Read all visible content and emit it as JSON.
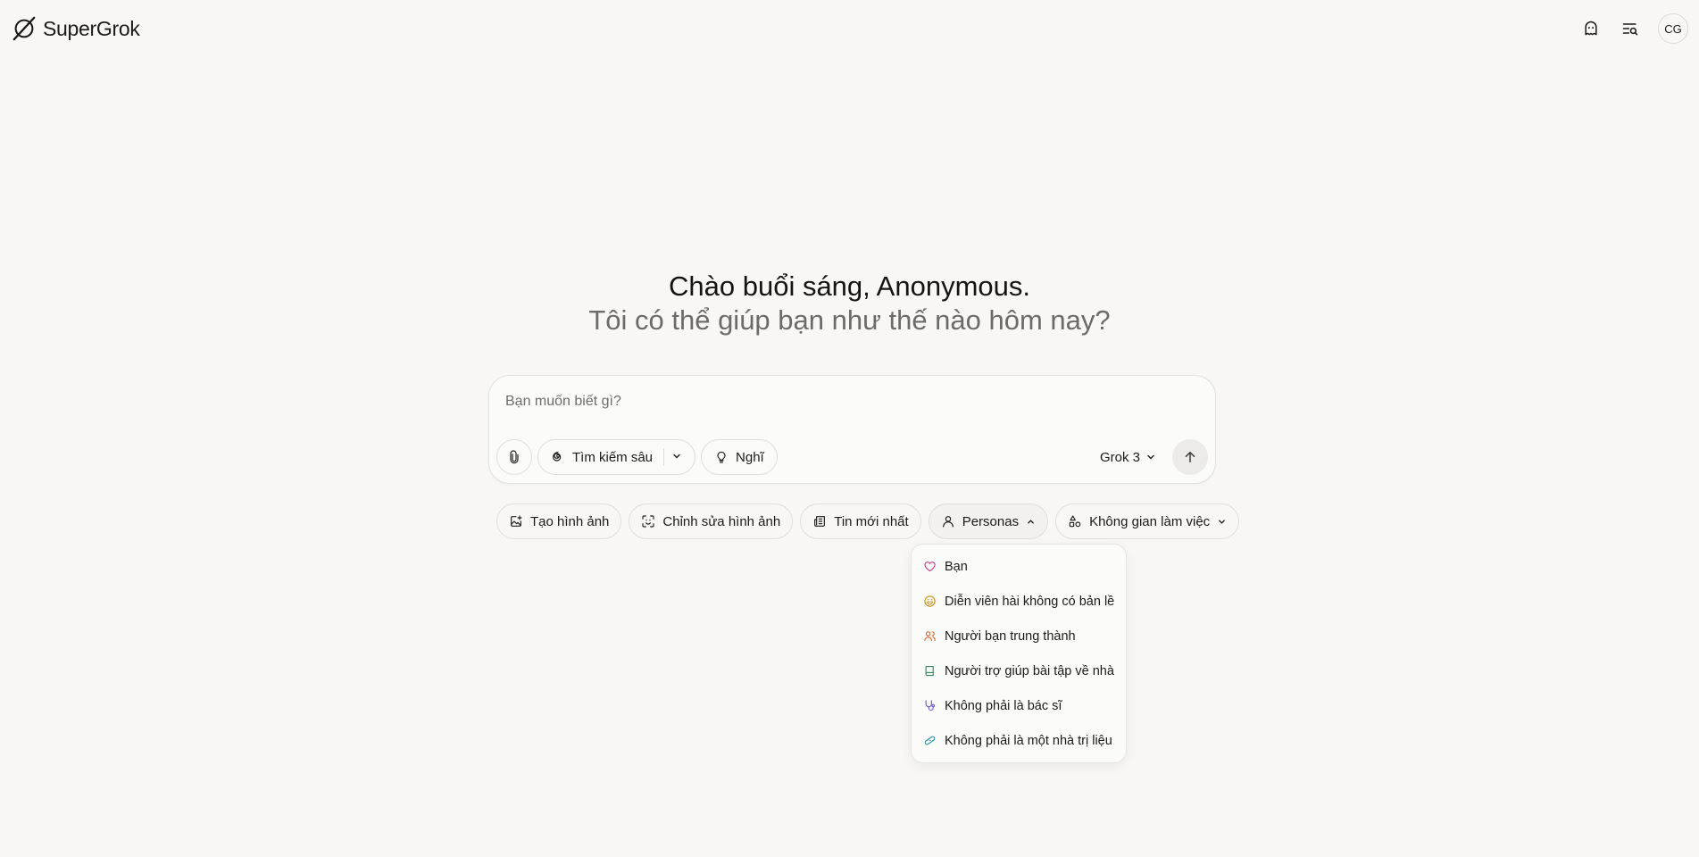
{
  "header": {
    "brand": "SuperGrok",
    "avatar_initials": "CG",
    "icons": [
      "ghost-icon",
      "history-search-icon"
    ]
  },
  "greeting": {
    "line1": "Chào buổi sáng, Anonymous.",
    "line2": "Tôi có thể giúp bạn như thế nào hôm nay?"
  },
  "composer": {
    "placeholder": "Bạn muốn biết gì?",
    "deep_search_label": "Tìm kiếm sâu",
    "think_label": "Nghĩ",
    "model_label": "Grok 3"
  },
  "suggestions": [
    {
      "label": "Tạo hình ảnh",
      "icon": "image-plus-icon"
    },
    {
      "label": "Chỉnh sửa hình ảnh",
      "icon": "scan-face-icon"
    },
    {
      "label": "Tin mới nhất",
      "icon": "newspaper-icon"
    },
    {
      "label": "Personas",
      "icon": "person-icon"
    },
    {
      "label": "Không gian làm việc",
      "icon": "shapes-icon"
    }
  ],
  "personas_menu": [
    {
      "label": "Bạn",
      "icon": "heart-icon",
      "color": "#c2427a"
    },
    {
      "label": "Diễn viên hài không có bản lề",
      "icon": "laugh-face-icon",
      "color": "#c9901a"
    },
    {
      "label": "Người bạn trung thành",
      "icon": "users-icon",
      "color": "#d4662a"
    },
    {
      "label": "Người trợ giúp bài tập về nhà",
      "icon": "book-icon",
      "color": "#2e8b57"
    },
    {
      "label": "Không phải là bác sĩ",
      "icon": "stethoscope-icon",
      "color": "#6a5acd"
    },
    {
      "label": "Không phải là một nhà trị liệu",
      "icon": "bandage-icon",
      "color": "#2a8fa0"
    }
  ]
}
